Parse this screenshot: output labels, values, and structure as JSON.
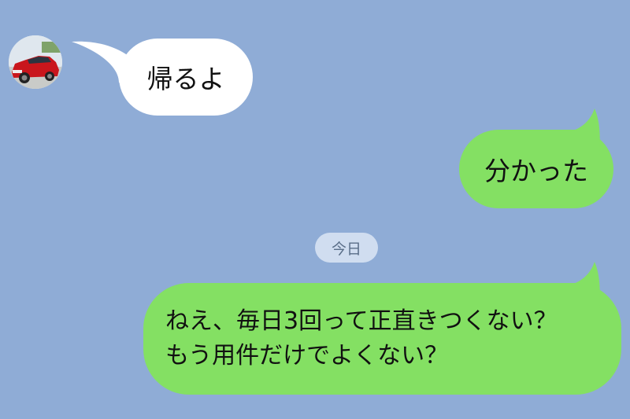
{
  "messages": {
    "incoming_1": "帰るよ",
    "outgoing_1": "分かった",
    "outgoing_2_line1": "ねえ、毎日3回って正直きつくない？",
    "outgoing_2_line2": "もう用件だけでよくない？"
  },
  "date_divider": "今日",
  "colors": {
    "background": "#8facd6",
    "incoming_bubble": "#ffffff",
    "outgoing_bubble": "#84e063",
    "date_pill": "#d0ddf0"
  },
  "icons": {
    "avatar": "red-car-photo-avatar"
  }
}
